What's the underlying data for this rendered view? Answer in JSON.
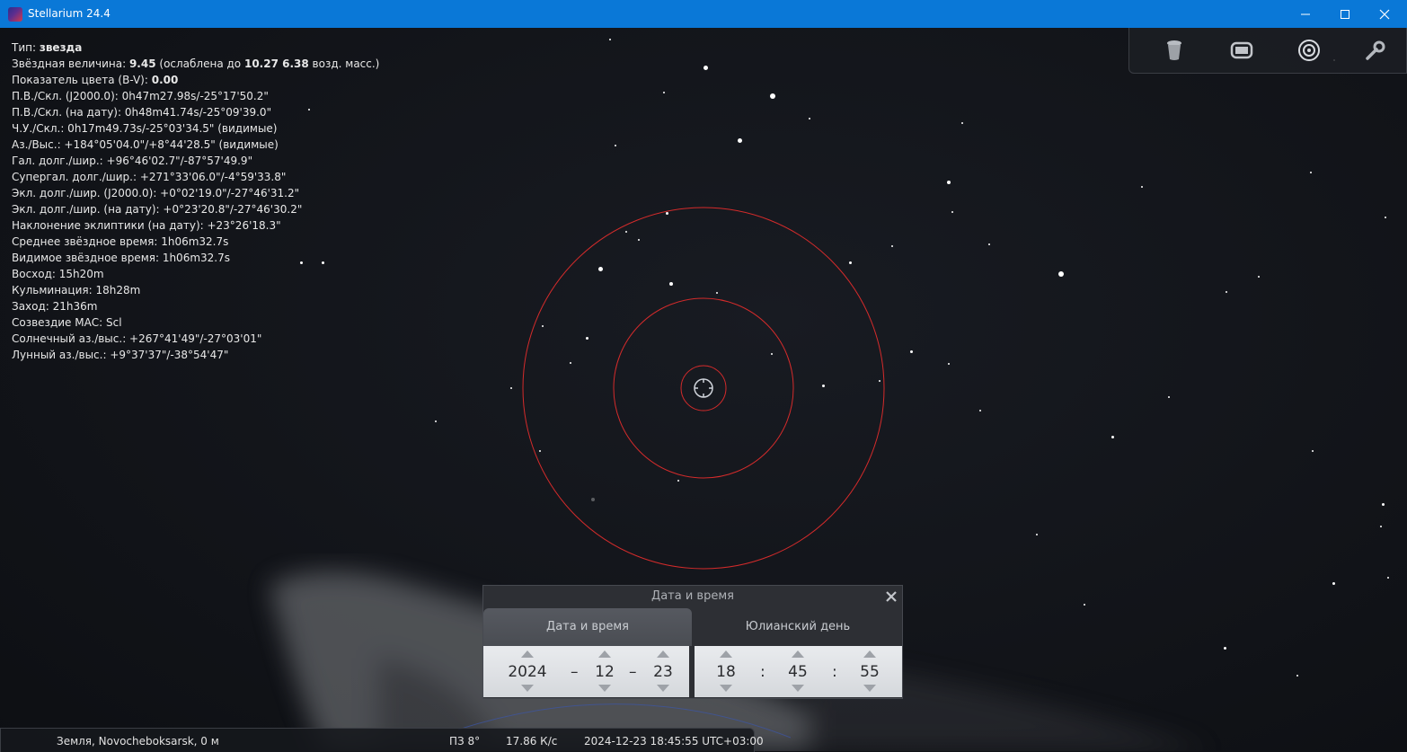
{
  "window": {
    "title": "Stellarium 24.4"
  },
  "info": {
    "type_label": "Тип:",
    "type_value": "звезда",
    "mag_label": "Звёздная величина:",
    "mag_value": "9.45",
    "mag_ext_pre": "(ослаблена до",
    "mag_ext_value": "10.27 6.38",
    "mag_ext_post": "возд. масс.)",
    "color_label": "Показатель цвета (B-V):",
    "color_value": "0.00",
    "lines": [
      "П.В./Скл. (J2000.0): 0h47m27.98s/-25°17'50.2\"",
      "П.В./Скл. (на дату): 0h48m41.74s/-25°09'39.0\"",
      "Ч.У./Скл.: 0h17m49.73s/-25°03'34.5\" (видимые)",
      "Аз./Выс.: +184°05'04.0\"/+8°44'28.5\" (видимые)",
      "Гал. долг./шир.: +96°46'02.7\"/-87°57'49.9\"",
      "Супергал. долг./шир.: +271°33'06.0\"/-4°59'33.8\"",
      "Экл. долг./шир. (J2000.0): +0°02'19.0\"/-27°46'31.2\"",
      "Экл. долг./шир. (на дату): +0°23'20.8\"/-27°46'30.2\"",
      "Наклонение эклиптики (на дату): +23°26'18.3\"",
      "Среднее звёздное время: 1h06m32.7s",
      "Видимое звёздное время: 1h06m32.7s",
      "Восход: 15h20m",
      "Кульминация: 18h28m",
      "Заход: 21h36m",
      "Созвездие МАС: Scl",
      "Солнечный аз./выс.: +267°41'49\"/-27°03'01\"",
      "Лунный аз./выс.: +9°37'37\"/-38°54'47\""
    ]
  },
  "toolbar": {
    "icons": [
      "trash-icon",
      "screen-icon",
      "target-icon",
      "wrench-icon"
    ]
  },
  "dialog": {
    "title": "Дата и время",
    "tab_active": "Дата и время",
    "tab_inactive": "Юлианский день",
    "year": "2024",
    "month": "12",
    "day": "23",
    "date_sep": "–",
    "hour": "18",
    "minute": "45",
    "second": "55",
    "time_sep": ":"
  },
  "status": {
    "location": "Земля, Novocheboksarsk, 0 м",
    "fov": "ПЗ 8°",
    "fps": "17.86 К/с",
    "datetime": "2024-12-23 18:45:55 UTC+03:00"
  },
  "colors": {
    "titlebar": "#0a78d7",
    "reticle": "#d42b2b",
    "sky": "#121419"
  }
}
